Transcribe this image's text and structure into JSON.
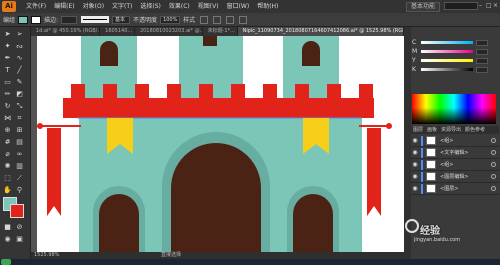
{
  "app": {
    "logo": "Ai"
  },
  "menu": [
    "文件(F)",
    "编辑(E)",
    "对象(O)",
    "文字(T)",
    "选择(S)",
    "效果(C)",
    "视图(V)",
    "窗口(W)",
    "帮助(H)"
  ],
  "workspace": "基本功能",
  "control": {
    "object_label": "编组",
    "stroke_weight": "",
    "stroke_profile": "基本",
    "opacity_label": "不透明度",
    "opacity_value": "100%",
    "style_label": "样式"
  },
  "tabs": [
    {
      "label": "1d.ai* @ 450.19% (RGB/..."
    },
    {
      "label": "1605140..."
    },
    {
      "label": "20180810023203.ai* @..."
    },
    {
      "label": "未标题-1*..."
    },
    {
      "label": "Nipic_11090734_20180807164607412086.ai* @ 1525.98% (RGB/预览)"
    }
  ],
  "status": {
    "zoom": "1525.98%",
    "tool": "直接选择"
  },
  "color_panel": {
    "channels": [
      {
        "label": "C",
        "value": ""
      },
      {
        "label": "M",
        "value": ""
      },
      {
        "label": "Y",
        "value": ""
      },
      {
        "label": "K",
        "value": ""
      }
    ]
  },
  "layers_tabs": [
    "图层",
    "画板",
    "资源导出",
    "颜色参考"
  ],
  "layers": [
    {
      "name": "<组>",
      "color": "#4f8cff"
    },
    {
      "name": "<文字编辑>",
      "color": "#4f8cff"
    },
    {
      "name": "<组>",
      "color": "#4f8cff"
    },
    {
      "name": "<图层编辑>",
      "color": "#4f8cff"
    },
    {
      "name": "<图层>",
      "color": "#4f8cff"
    }
  ],
  "watermark": {
    "text": "经验",
    "sub": "jingyan.baidu.com"
  },
  "colors": {
    "teal": "#7cc6b8",
    "teal_dark": "#68ada1",
    "red": "#e2231a",
    "yellow": "#f7cf18",
    "brown": "#4a2314"
  }
}
